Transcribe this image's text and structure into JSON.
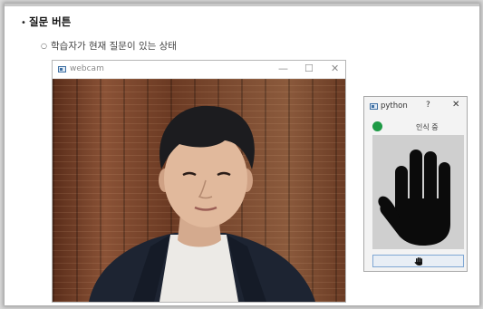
{
  "document": {
    "heading_bullet": "•",
    "heading": "질문 버튼",
    "sub_bullet": "○",
    "subheading": "학습자가 현재 질문이 있는 상태"
  },
  "webcam_window": {
    "title": "webcam",
    "minimize": "—",
    "maximize": "☐",
    "close": "✕",
    "icon": "app-window-icon"
  },
  "python_window": {
    "title": "python",
    "help": "?",
    "close": "✕",
    "status_text": "인식 중",
    "status_color": "#1e9a45",
    "hand_icon": "raised-hand-icon",
    "button_icon": "hand-icon"
  }
}
